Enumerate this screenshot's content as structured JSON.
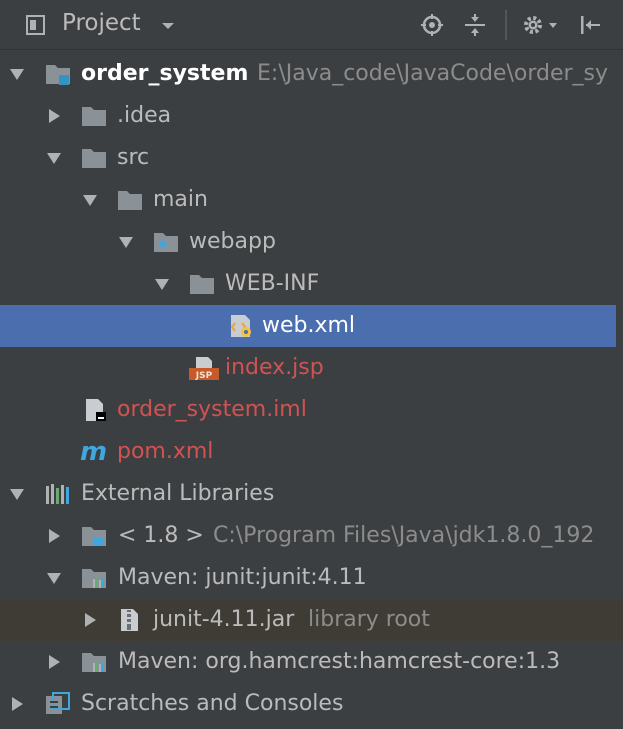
{
  "toolbar": {
    "title": "Project",
    "icons": [
      "project-view-icon",
      "dropdown-chevron-icon",
      "locate-icon",
      "collapse-all-icon",
      "settings-icon",
      "hide-panel-icon"
    ]
  },
  "tree": {
    "root": {
      "name": "order_system",
      "path": "E:\\Java_code\\JavaCode\\order_sy"
    },
    "idea": ".idea",
    "src": "src",
    "main": "main",
    "webapp": "webapp",
    "webinf": "WEB-INF",
    "webxml": "web.xml",
    "indexjsp": "index.jsp",
    "iml": "order_system.iml",
    "pom": "pom.xml",
    "extlibs": "External Libraries",
    "jdk": {
      "name": "< 1.8 >",
      "path": "C:\\Program Files\\Java\\jdk1.8.0_192"
    },
    "junit": "Maven: junit:junit:4.11",
    "junitjar": {
      "name": "junit-4.11.jar",
      "hint": "library root"
    },
    "hamcrest": "Maven: org.hamcrest:hamcrest-core:1.3",
    "scratches": "Scratches and Consoles"
  },
  "colors": {
    "background": "#3c3f41",
    "selection": "#4b6eaf",
    "modified_file": "#d25252",
    "hint_text": "#8c8c8c"
  }
}
